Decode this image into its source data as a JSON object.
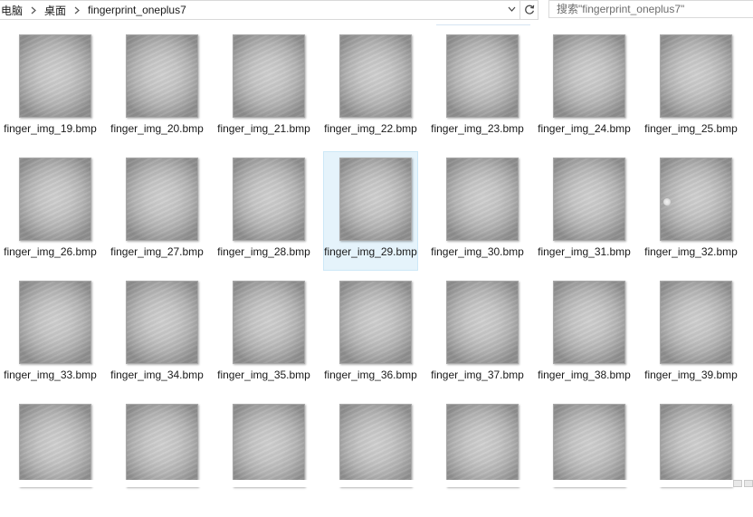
{
  "breadcrumb": [
    "电脑",
    "桌面",
    "fingerprint_oneplus7"
  ],
  "search": {
    "placeholder": "搜索\"fingerprint_oneplus7\""
  },
  "files": [
    "finger_img_19.bmp",
    "finger_img_20.bmp",
    "finger_img_21.bmp",
    "finger_img_22.bmp",
    "finger_img_23.bmp",
    "finger_img_24.bmp",
    "finger_img_25.bmp",
    "finger_img_26.bmp",
    "finger_img_27.bmp",
    "finger_img_28.bmp",
    "finger_img_29.bmp",
    "finger_img_30.bmp",
    "finger_img_31.bmp",
    "finger_img_32.bmp",
    "finger_img_33.bmp",
    "finger_img_34.bmp",
    "finger_img_35.bmp",
    "finger_img_36.bmp",
    "finger_img_37.bmp",
    "finger_img_38.bmp",
    "finger_img_39.bmp",
    "",
    "",
    "",
    "",
    "",
    "",
    ""
  ],
  "selected_file": "finger_img_29.bmp",
  "colors": {
    "selection_bg": "#e5f3fb",
    "selection_border": "#cde8f7",
    "thumbnail_gray": "#c6c6c6"
  },
  "icons": {
    "separator": "chevron-right-icon",
    "dropdown": "chevron-down-icon",
    "refresh": "refresh-icon"
  }
}
